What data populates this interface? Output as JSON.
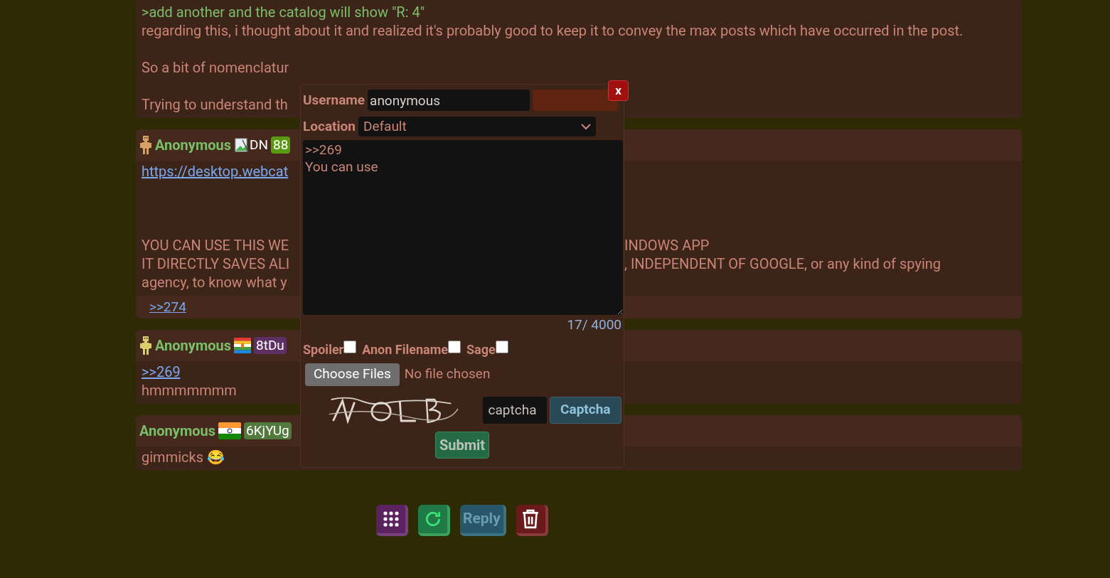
{
  "posts": [
    {
      "body": [
        {
          "kind": "greentext",
          "left": ">add another and the catalog will show \"R: 4\""
        },
        {
          "kind": "text",
          "left": "regarding this, i thought about it and realized it's probably good to keep it to convey the max posts which have occurred in the post."
        },
        {
          "kind": "blank"
        },
        {
          "kind": "text",
          "left": "So a bit of nomenclatur"
        },
        {
          "kind": "blank"
        },
        {
          "kind": "text",
          "left": "Trying to understand th"
        }
      ]
    },
    {
      "header": {
        "avatar": {
          "kind": "monkey"
        },
        "name": "Anonymous",
        "flag": {
          "kind": "broken",
          "alt": "DN"
        },
        "badge": {
          "text": "88",
          "color": "#5a9a12"
        }
      },
      "body": [
        {
          "kind": "link",
          "left": "https://desktop.webcat"
        },
        {
          "kind": "blank"
        },
        {
          "kind": "blank"
        },
        {
          "kind": "blank"
        },
        {
          "kind": "text",
          "left": "YOU CAN USE THIS WE",
          "right": "INDOWS APP"
        },
        {
          "kind": "text",
          "left": "IT DIRECTLY SAVES ALI",
          "right": ", INDEPENDENT OF GOOGLE, or any kind of spying"
        },
        {
          "kind": "text",
          "left": "agency, to know what y"
        }
      ],
      "footer": ">>274"
    },
    {
      "header": {
        "avatar": {
          "kind": "robot"
        },
        "name": "Anonymous",
        "flag": {
          "kind": "stripes"
        },
        "badge": {
          "text": "8tDu",
          "color": "#5e2f63"
        }
      },
      "body": [
        {
          "kind": "link",
          "left": ">>269"
        },
        {
          "kind": "text",
          "left": "hmmmmmmm"
        }
      ]
    },
    {
      "header": {
        "name": "Anonymous",
        "flag": {
          "kind": "india"
        },
        "badge": {
          "text": "6KjYUg",
          "color": "#527a3c"
        }
      },
      "body": [
        {
          "kind": "text",
          "left": "gimmicks 😂"
        }
      ]
    }
  ],
  "reply_form": {
    "close": "x",
    "username": {
      "label": "Username",
      "value": "anonymous"
    },
    "location": {
      "label": "Location",
      "value": "Default"
    },
    "message": ">>269\nYou can use",
    "counter": "17/ 4000",
    "options": [
      {
        "label": "Spoiler",
        "checked": false
      },
      {
        "label": "Anon Filename",
        "checked": false
      },
      {
        "label": "Sage",
        "checked": false
      }
    ],
    "file": {
      "button": "Choose Files",
      "status": "No file chosen"
    },
    "captcha": {
      "placeholder": "captcha",
      "button": "Captcha"
    },
    "submit": "Submit"
  },
  "toolbar": [
    {
      "kind": "grid"
    },
    {
      "kind": "refresh"
    },
    {
      "kind": "reply",
      "label": "Reply"
    },
    {
      "kind": "delete"
    }
  ]
}
